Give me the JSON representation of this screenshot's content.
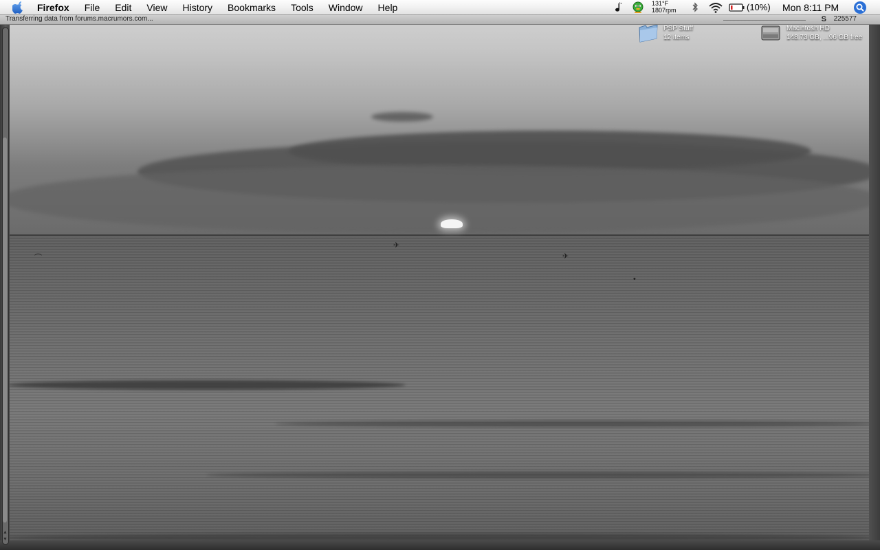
{
  "menubar": {
    "app_name": "Firefox",
    "items": [
      {
        "label": "File"
      },
      {
        "label": "Edit"
      },
      {
        "label": "View"
      },
      {
        "label": "History"
      },
      {
        "label": "Bookmarks"
      },
      {
        "label": "Tools"
      },
      {
        "label": "Window"
      },
      {
        "label": "Help"
      }
    ],
    "extras": {
      "temperature": "131°F",
      "fan_speed": "1807rpm",
      "battery": "(10%)",
      "clock": "Mon 8:11 PM",
      "icons": [
        "music-note-icon",
        "adium-duck-icon",
        "bluetooth-icon",
        "wifi-icon",
        "battery-icon",
        "spotlight-icon"
      ]
    }
  },
  "statusbar": {
    "text": "Transferring data from forums.macrumors.com...",
    "right_text": "225577",
    "right_symbol": "S"
  },
  "desktop_icons": [
    {
      "name": "PSP Stuff",
      "info": "12 items",
      "icon": "folder-icon"
    },
    {
      "name": "Macintosh HD",
      "info": "148.73 GB, ...96 GB free",
      "icon": "hard-drive-icon"
    }
  ],
  "colors": {
    "menubar_top": "#fdfdfd",
    "menubar_bottom": "#e2e2e2",
    "spotlight_blue": "#2a6fd6",
    "window_frame": "#3a3a3a"
  }
}
